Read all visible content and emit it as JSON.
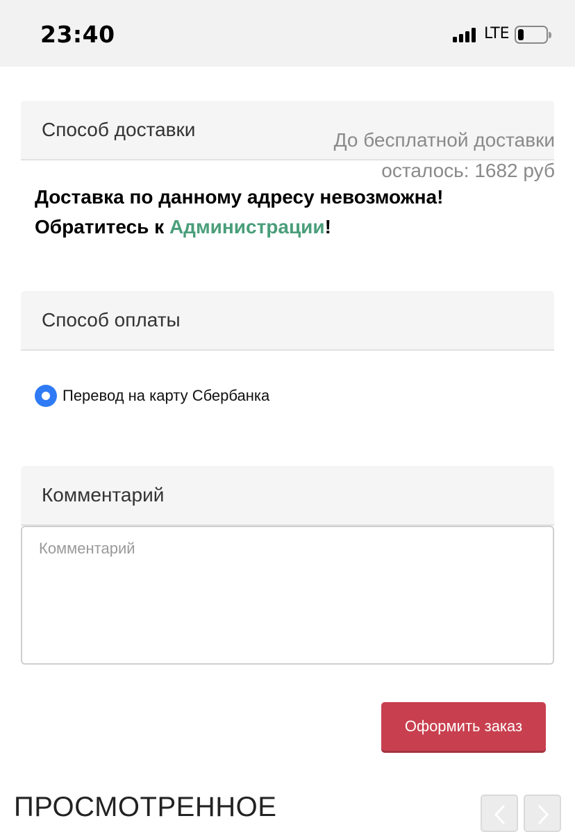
{
  "status_bar": {
    "time": "23:40",
    "network": "LTE"
  },
  "delivery": {
    "title": "Способ доставки",
    "free_delivery_line1": "До бесплатной доставки",
    "free_delivery_line2": "осталось: 1682 руб",
    "warning_line1": "Доставка по данному адресу невозможна!",
    "warning_line2_prefix": "Обратитесь к ",
    "warning_link": "Администрации",
    "warning_line2_suffix": "!"
  },
  "payment": {
    "title": "Способ оплаты",
    "option_label": "Перевод на карту Сбербанка",
    "option_selected": true
  },
  "comment": {
    "title": "Комментарий",
    "placeholder": "Комментарий",
    "value": ""
  },
  "order_button_label": "Оформить заказ",
  "viewed": {
    "title": "ПРОСМОТРЕННОЕ"
  },
  "colors": {
    "accent_link": "#4a9e7a",
    "radio": "#2f7bf5",
    "order_button": "#c8404f"
  }
}
